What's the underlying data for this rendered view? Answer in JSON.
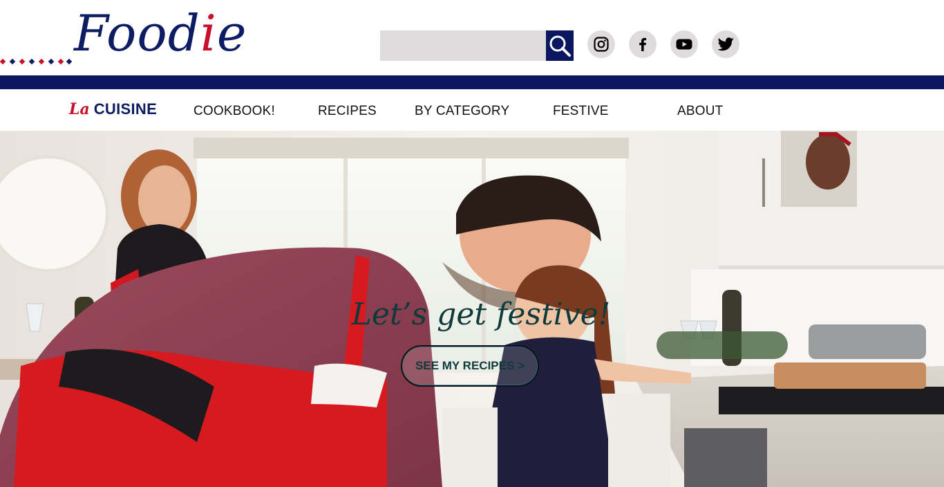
{
  "header": {
    "logo_text": "Food",
    "logo_accent": "i",
    "logo_tail": "e",
    "search": {
      "placeholder": "",
      "value": ""
    },
    "social": [
      {
        "name": "instagram-icon"
      },
      {
        "name": "facebook-icon"
      },
      {
        "name": "youtube-icon"
      },
      {
        "name": "twitter-icon"
      }
    ]
  },
  "nav": {
    "brand_la": "La",
    "brand_cuisine": "CUISINE",
    "links": [
      "COOKBOOK!",
      "RECIPES",
      "BY CATEGORY",
      "FESTIVE",
      "ABOUT"
    ]
  },
  "hero": {
    "title": "Let’s get festive!",
    "button_label": "SEE MY RECIPES >"
  },
  "colors": {
    "navy": "#0a1660",
    "red": "#c8102e",
    "search_bg": "#e0dcdd"
  }
}
